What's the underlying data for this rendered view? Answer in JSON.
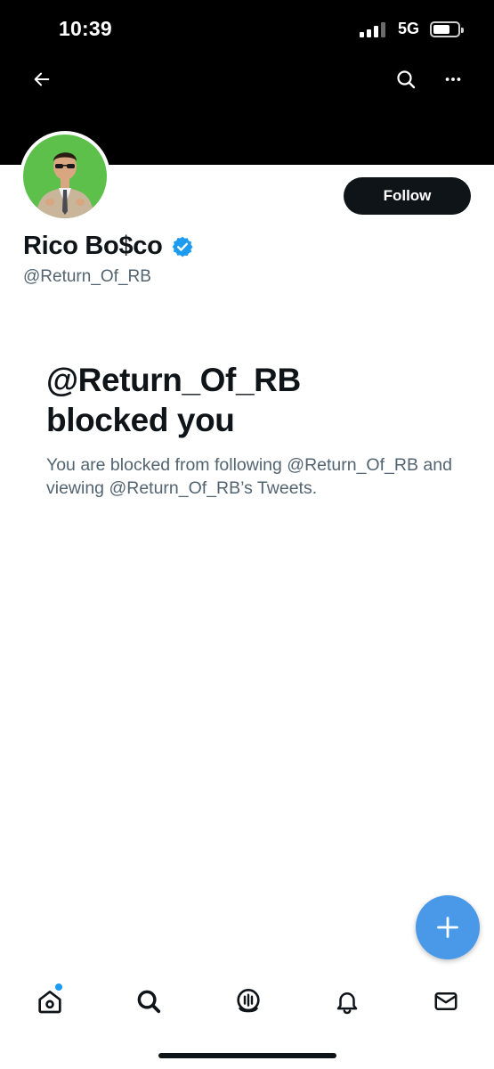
{
  "status_bar": {
    "time": "10:39",
    "network": "5G",
    "signal_bars_active": 3,
    "signal_bars_total": 4,
    "battery_level": 0.7
  },
  "header": {
    "back_icon": "arrow-left-icon",
    "search_icon": "search-icon",
    "more_icon": "more-horizontal-icon"
  },
  "profile": {
    "display_name": "Rico Bo$co",
    "verified": true,
    "handle": "@Return_Of_RB",
    "follow_label": "Follow"
  },
  "blocked": {
    "title_line1": "@Return_Of_RB",
    "title_line2": "blocked you",
    "description": "You are blocked from following @Return_Of_RB and viewing @Return_Of_RB’s Tweets."
  },
  "fab": {
    "icon": "plus-icon"
  },
  "tabbar": {
    "items": [
      {
        "name": "home",
        "icon": "home-icon",
        "has_dot": true
      },
      {
        "name": "search",
        "icon": "search-icon"
      },
      {
        "name": "spaces",
        "icon": "spaces-icon"
      },
      {
        "name": "notifications",
        "icon": "bell-icon"
      },
      {
        "name": "messages",
        "icon": "mail-icon"
      }
    ]
  },
  "colors": {
    "banner": "#000000",
    "accent": "#1d9bf0",
    "fab": "#4a99e9",
    "text_primary": "#0f1419",
    "text_secondary": "#536471",
    "avatar_bg": "#5cc04a"
  }
}
